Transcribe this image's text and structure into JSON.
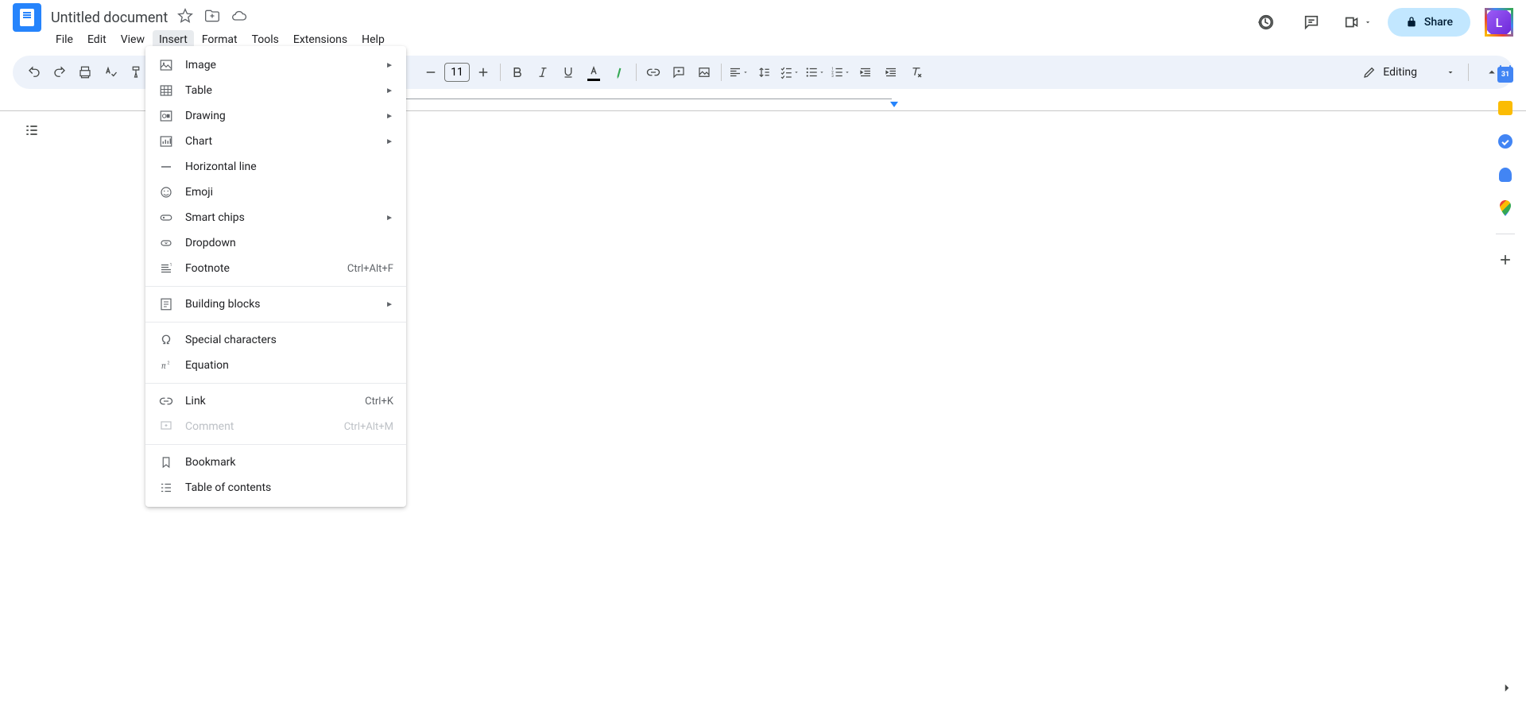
{
  "title": "Untitled document",
  "menus": [
    "File",
    "Edit",
    "View",
    "Insert",
    "Format",
    "Tools",
    "Extensions",
    "Help"
  ],
  "active_menu_index": 3,
  "share_label": "Share",
  "avatar_letter": "L",
  "editing_mode": "Editing",
  "font_size": "11",
  "calendar_day": "31",
  "dropdown": {
    "groups": [
      [
        {
          "icon": "image",
          "label": "Image",
          "submenu": true
        },
        {
          "icon": "table",
          "label": "Table",
          "submenu": true
        },
        {
          "icon": "drawing",
          "label": "Drawing",
          "submenu": true
        },
        {
          "icon": "chart",
          "label": "Chart",
          "submenu": true
        },
        {
          "icon": "hline",
          "label": "Horizontal line"
        },
        {
          "icon": "emoji",
          "label": "Emoji"
        },
        {
          "icon": "chips",
          "label": "Smart chips",
          "submenu": true
        },
        {
          "icon": "dropdown",
          "label": "Dropdown"
        },
        {
          "icon": "footnote",
          "label": "Footnote",
          "shortcut": "Ctrl+Alt+F"
        }
      ],
      [
        {
          "icon": "blocks",
          "label": "Building blocks",
          "submenu": true
        }
      ],
      [
        {
          "icon": "omega",
          "label": "Special characters"
        },
        {
          "icon": "equation",
          "label": "Equation"
        }
      ],
      [
        {
          "icon": "link",
          "label": "Link",
          "shortcut": "Ctrl+K"
        },
        {
          "icon": "comment",
          "label": "Comment",
          "shortcut": "Ctrl+Alt+M",
          "disabled": true
        }
      ],
      [
        {
          "icon": "bookmark",
          "label": "Bookmark"
        },
        {
          "icon": "toc",
          "label": "Table of contents"
        }
      ]
    ]
  }
}
